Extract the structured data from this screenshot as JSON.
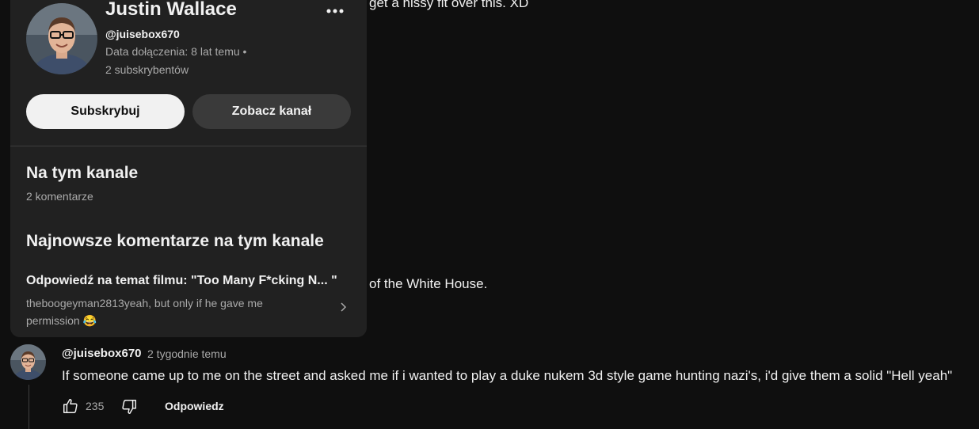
{
  "background": {
    "line_top": "get a hissy fit over this. XD",
    "line_mid": "of the White House."
  },
  "popup": {
    "name": "Justin Wallace",
    "handle": "@juisebox670",
    "joined": "Data dołączenia: 8 lat temu •",
    "subscribers": "2 subskrybentów",
    "subscribe_label": "Subskrybuj",
    "view_channel_label": "Zobacz kanał",
    "on_channel_title": "Na tym kanale",
    "on_channel_count": "2 komentarze",
    "recent_title": "Najnowsze komentarze na tym kanale",
    "recent_item": {
      "title": "Odpowiedź na temat filmu: \"Too Many F*cking N... \"",
      "snippet": "theboogeyman2813yeah, but only if he gave me permission 😂"
    },
    "more_icon": "more-vert-icon",
    "chevron_icon": "chevron-right-icon"
  },
  "comment": {
    "handle": "@juisebox670",
    "time": "2 tygodnie temu",
    "text": "If someone came up to me on the street and asked me if i wanted to play a duke nukem 3d style game hunting nazi's, i'd give them a solid \"Hell yeah\"",
    "likes": "235",
    "reply_label": "Odpowiedz",
    "like_icon": "thumbs-up-icon",
    "dislike_icon": "thumbs-down-icon"
  },
  "colors": {
    "background": "#0f0f0f",
    "card": "#212121",
    "subscribe_bg": "#f1f1f1",
    "secondary_btn_bg": "#3a3a3a",
    "muted_text": "#aaaaaa"
  }
}
